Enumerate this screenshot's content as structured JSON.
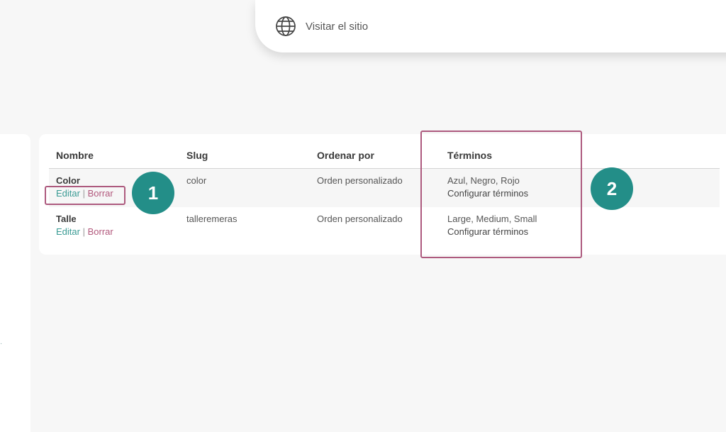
{
  "topbar": {
    "visit_label": "Visitar el sitio",
    "icon": "globe-icon"
  },
  "table": {
    "headers": [
      "Nombre",
      "Slug",
      "Ordenar por",
      "Términos"
    ],
    "rows": [
      {
        "name": "Color",
        "edit": "Editar",
        "separator": "|",
        "delete": "Borrar",
        "slug": "color",
        "order": "Orden personalizado",
        "terms": "Azul, Negro, Rojo",
        "configure": "Configurar términos"
      },
      {
        "name": "Talle",
        "edit": "Editar",
        "separator": "|",
        "delete": "Borrar",
        "slug": "talleremeras",
        "order": "Orden personalizado",
        "terms": "Large, Medium, Small",
        "configure": "Configurar términos"
      }
    ]
  },
  "annotations": {
    "badge_1": "1",
    "badge_2": "2"
  },
  "colors": {
    "accent_teal": "#238e88",
    "highlight": "#ad5a7e",
    "link_edit": "#3a9b94",
    "link_delete": "#b2587c"
  }
}
